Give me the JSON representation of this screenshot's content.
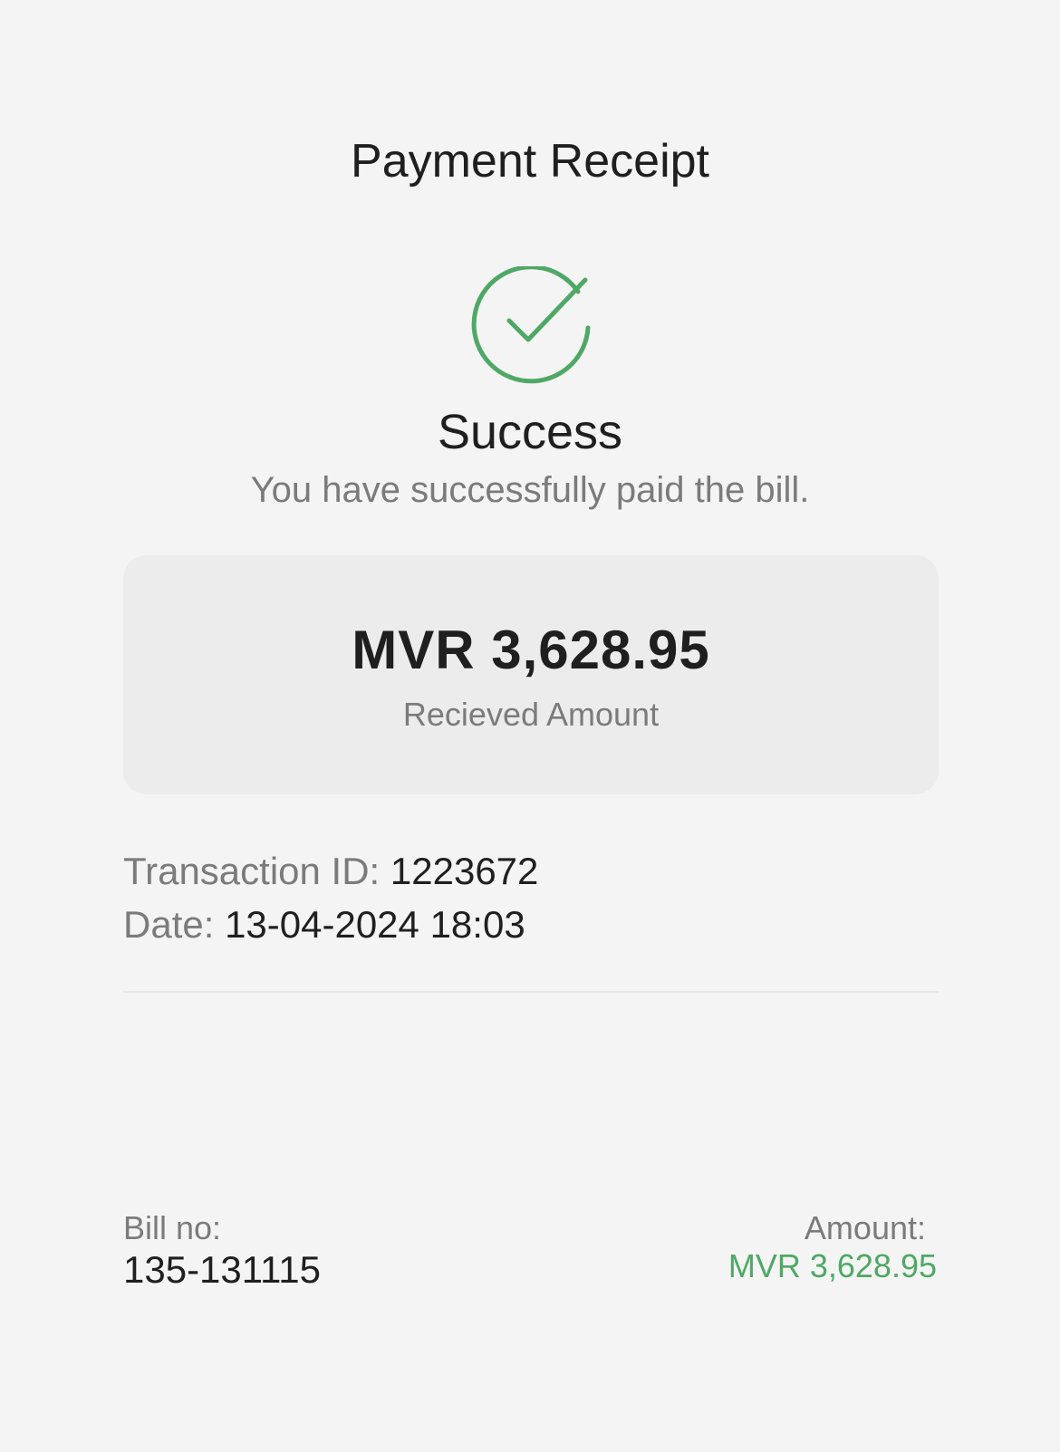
{
  "header": {
    "title": "Payment Receipt"
  },
  "status": {
    "icon": "check-circle-icon",
    "title": "Success",
    "message": "You have successfully paid the bill.",
    "color": "#4fa865"
  },
  "amount_card": {
    "amount": "MVR 3,628.95",
    "caption": "Recieved Amount"
  },
  "details": {
    "transaction_label": "Transaction ID:",
    "transaction_value": "1223672",
    "date_label": "Date:",
    "date_value": "13-04-2024 18:03"
  },
  "bill": {
    "bill_label": "Bill no:",
    "bill_value": "135-131115",
    "amount_label": "Amount:",
    "amount_value": "MVR 3,628.95"
  }
}
